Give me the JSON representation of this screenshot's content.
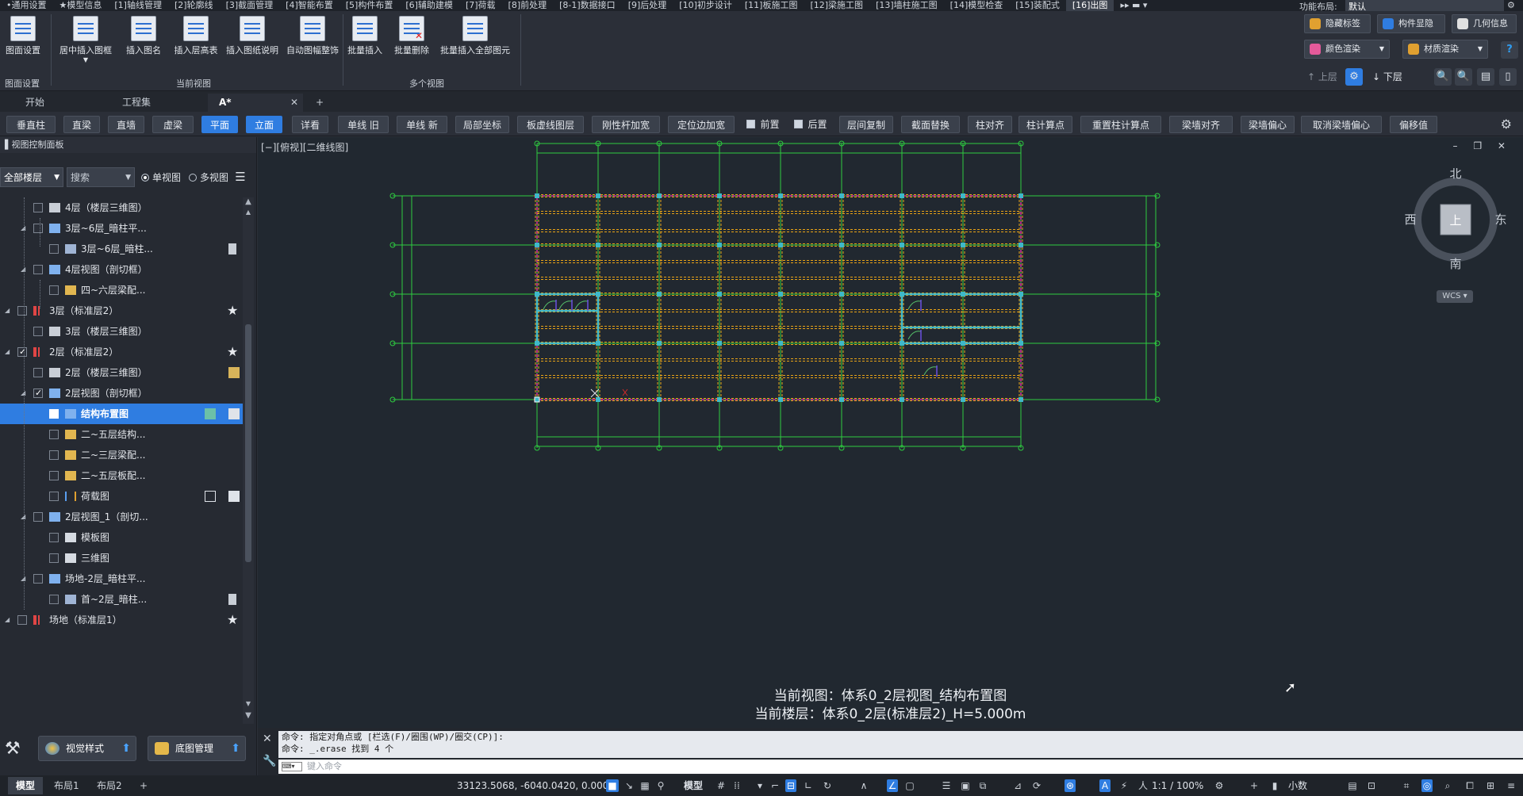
{
  "menubar": {
    "tabs": [
      "•通用设置",
      "★模型信息",
      "[1]轴线管理",
      "[2]轮廓线",
      "[3]截面管理",
      "[4]智能布置",
      "[5]构件布置",
      "[6]辅助建模",
      "[7]荷载",
      "[8]前处理",
      "[8-1]数据接口",
      "[9]后处理",
      "[10]初步设计",
      "[11]板施工图",
      "[12]梁施工图",
      "[13]墙柱施工图",
      "[14]模型检查",
      "[15]装配式",
      "[16]出图"
    ],
    "active_tab": "[16]出图",
    "layout_label": "功能布局:",
    "layout_value": "默认"
  },
  "ribbon": {
    "buttons": [
      {
        "id": "page-setup",
        "label": "图面设置"
      },
      {
        "id": "insert-frame-center",
        "label": "居中插入图框"
      },
      {
        "id": "insert-title",
        "label": "插入图名"
      },
      {
        "id": "insert-level-table",
        "label": "插入层高表"
      },
      {
        "id": "insert-drawing-notes",
        "label": "插入图纸说明"
      },
      {
        "id": "auto-fit-frame",
        "label": "自动图幅整饰"
      },
      {
        "id": "batch-insert",
        "label": "批量插入"
      },
      {
        "id": "batch-delete",
        "label": "批量删除"
      },
      {
        "id": "batch-insert-all",
        "label": "批量插入全部图元"
      }
    ],
    "groups": [
      "图面设置",
      "当前视图",
      "多个视图"
    ],
    "right_buttons": {
      "hide_tags": "隐藏标签",
      "component_display": "构件显隐",
      "geometry_info": "几何信息",
      "color_render": "颜色渲染",
      "material_render": "材质渲染",
      "upper_floor": "上层",
      "lower_floor": "下层"
    }
  },
  "doctabs": {
    "tabs": [
      "开始",
      "工程集",
      "A*"
    ],
    "add": "+",
    "close": "✕"
  },
  "cmdbar": {
    "buttons": [
      {
        "label": "垂直柱",
        "on": false
      },
      {
        "label": "直梁",
        "on": false
      },
      {
        "label": "直墙",
        "on": false
      },
      {
        "label": "虚梁",
        "on": false
      },
      {
        "label": "平面",
        "on": true
      },
      {
        "label": "立面",
        "on": true
      },
      {
        "label": "详看",
        "on": false
      },
      {
        "label": "单线 旧",
        "on": false
      },
      {
        "label": "单线 新",
        "on": false
      },
      {
        "label": "局部坐标",
        "on": false
      },
      {
        "label": "板虚线图层",
        "on": false
      },
      {
        "label": "刚性杆加宽",
        "on": false
      },
      {
        "label": "定位边加宽",
        "on": false
      },
      {
        "label": "前置",
        "on": false
      },
      {
        "label": "后置",
        "on": false
      },
      {
        "label": "层间复制",
        "on": false
      },
      {
        "label": "截面替换",
        "on": false
      },
      {
        "label": "柱对齐",
        "on": false
      },
      {
        "label": "柱计算点",
        "on": false
      },
      {
        "label": "重置柱计算点",
        "on": false
      },
      {
        "label": "梁墙对齐",
        "on": false
      },
      {
        "label": "梁墙偏心",
        "on": false
      },
      {
        "label": "取消梁墙偏心",
        "on": false
      },
      {
        "label": "偏移值",
        "on": false
      }
    ]
  },
  "leftpanel": {
    "title": "视图控制面板",
    "floor_filter": "全部楼层",
    "search_placeholder": "搜索",
    "single_view": "单视图",
    "multi_view": "多视图",
    "tree": [
      {
        "label": "4层（楼层三维图）",
        "level": 2,
        "icon": "grid",
        "checked": false,
        "expand": "",
        "action": ""
      },
      {
        "label": "3层~6层_暗柱平...",
        "level": 2,
        "icon": "sheet",
        "checked": false,
        "expand": "▲",
        "action": ""
      },
      {
        "label": "3层~6层_暗柱...",
        "level": 3,
        "icon": "doc",
        "checked": false,
        "expand": "",
        "action": "clip"
      },
      {
        "label": "4层视图（剖切框）",
        "level": 2,
        "icon": "sheet",
        "checked": false,
        "expand": "▲",
        "action": ""
      },
      {
        "label": "四~六层梁配...",
        "level": 3,
        "icon": "folder",
        "checked": false,
        "expand": "",
        "action": ""
      },
      {
        "label": "3层（标准层2）",
        "level": 1,
        "icon": "floor",
        "checked": false,
        "expand": "▲",
        "action": "star"
      },
      {
        "label": "3层（楼层三维图）",
        "level": 2,
        "icon": "grid",
        "checked": false,
        "expand": "",
        "action": ""
      },
      {
        "label": "2层（标准层2）",
        "level": 1,
        "icon": "floor",
        "checked": true,
        "expand": "▲",
        "action": "star"
      },
      {
        "label": "2层（楼层三维图）",
        "level": 2,
        "icon": "grid",
        "checked": false,
        "expand": "",
        "action": "img"
      },
      {
        "label": "2层视图（剖切框）",
        "level": 2,
        "icon": "sheet",
        "checked": true,
        "expand": "▲",
        "action": ""
      },
      {
        "label": "结构布置图",
        "level": 3,
        "icon": "sheet",
        "checked": true,
        "expand": "",
        "action": "sel",
        "selected": true
      },
      {
        "label": "二~五层结构...",
        "level": 3,
        "icon": "folder",
        "checked": false,
        "expand": "",
        "action": ""
      },
      {
        "label": "二~三层梁配...",
        "level": 3,
        "icon": "folder",
        "checked": false,
        "expand": "",
        "action": ""
      },
      {
        "label": "二~五层板配...",
        "level": 3,
        "icon": "folder",
        "checked": false,
        "expand": "",
        "action": ""
      },
      {
        "label": "荷载图",
        "level": 3,
        "icon": "load",
        "checked": false,
        "expand": "",
        "action": "pair"
      },
      {
        "label": "2层视图_1（剖切...",
        "level": 2,
        "icon": "sheet",
        "checked": false,
        "expand": "▲",
        "action": ""
      },
      {
        "label": "模板图",
        "level": 3,
        "icon": "mold",
        "checked": false,
        "expand": "",
        "action": ""
      },
      {
        "label": "三维图",
        "level": 3,
        "icon": "cube",
        "checked": false,
        "expand": "",
        "action": ""
      },
      {
        "label": "场地-2层_暗柱平...",
        "level": 2,
        "icon": "sheet",
        "checked": false,
        "expand": "▲",
        "action": ""
      },
      {
        "label": "首~2层_暗柱...",
        "level": 3,
        "icon": "doc",
        "checked": false,
        "expand": "",
        "action": "clip"
      },
      {
        "label": "场地（标准层1）",
        "level": 1,
        "icon": "floor",
        "checked": false,
        "expand": "▲",
        "action": "star"
      }
    ]
  },
  "viewport": {
    "label": "[−][俯视][二维线图]",
    "controls": "–  ❐  ✕",
    "current_view": "当前视图：体系0_2层视图_结构布置图",
    "current_floor": "当前楼层：体系0_2层(标准层2)_H=5.000m",
    "compass": {
      "north": "北",
      "south": "南",
      "east": "东",
      "west": "西",
      "top": "上",
      "wcs": "WCS"
    }
  },
  "cmdline": {
    "history": [
      "命令: 指定对角点或 [栏选(F)/圈围(WP)/圈交(CP)]:",
      "命令: _.erase 找到 4 个"
    ],
    "placeholder": "键入命令"
  },
  "lp_tools": {
    "view_style": "视觉样式",
    "base_manage": "底图管理"
  },
  "statusbar": {
    "tabs": [
      "模型",
      "布局1",
      "布局2"
    ],
    "add": "+",
    "coords": "33123.5068, -6040.0420, 0.0000",
    "model": "模型",
    "scale": "1:1 / 100%",
    "units": "小数"
  },
  "colors": {
    "accent": "#2f7de1",
    "grid_axis": "#2ecc40",
    "beam": "#e8a317",
    "slab_edge": "#d02f9e",
    "column": "#3fb8c9",
    "wall": "#d12a2a"
  }
}
